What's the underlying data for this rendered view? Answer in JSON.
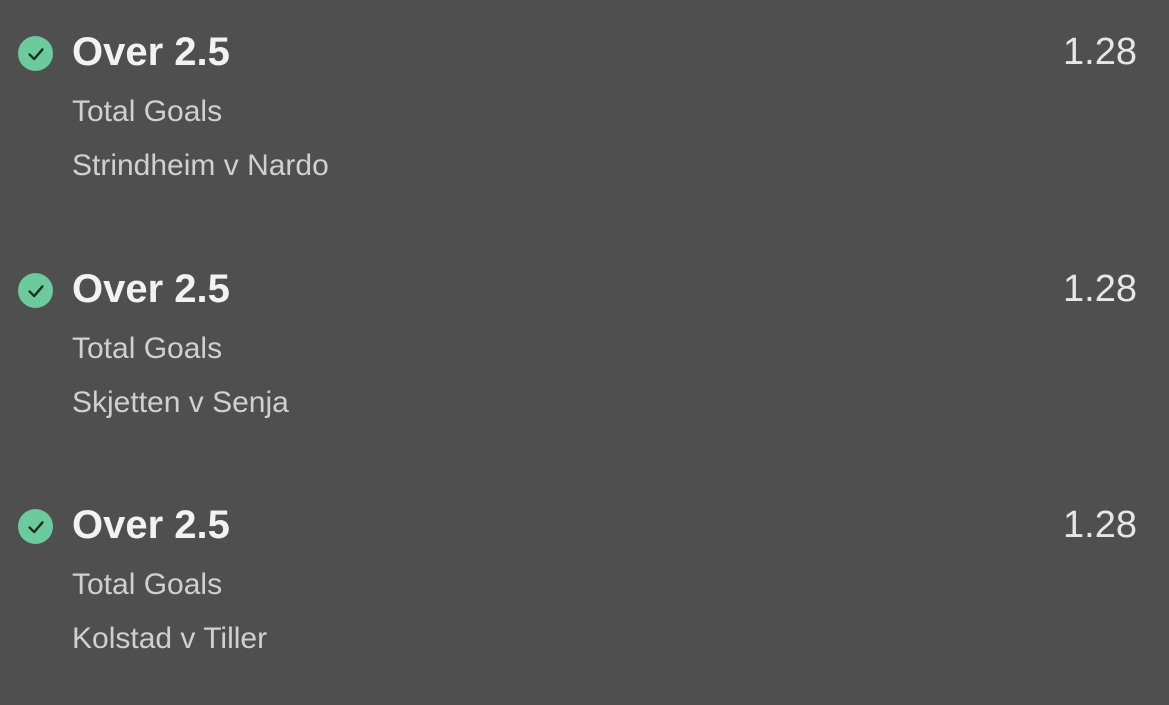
{
  "colors": {
    "background": "#4f4f4f",
    "check_circle": "#6ccb9c",
    "check_mark": "#1f2e26",
    "primary_text": "#f2f2f2",
    "secondary_text": "#d0d0d0"
  },
  "bets": [
    {
      "status_icon": "check-circle-icon",
      "selection": "Over 2.5",
      "odds": "1.28",
      "market": "Total Goals",
      "event": "Strindheim v Nardo"
    },
    {
      "status_icon": "check-circle-icon",
      "selection": "Over 2.5",
      "odds": "1.28",
      "market": "Total Goals",
      "event": "Skjetten v Senja"
    },
    {
      "status_icon": "check-circle-icon",
      "selection": "Over 2.5",
      "odds": "1.28",
      "market": "Total Goals",
      "event": "Kolstad v Tiller"
    }
  ]
}
